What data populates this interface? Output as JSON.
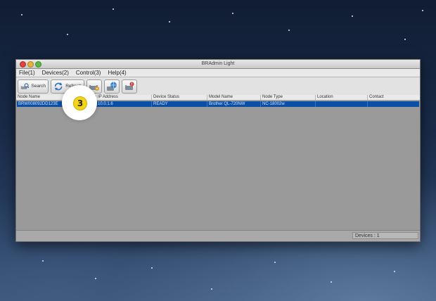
{
  "window": {
    "title": "BRAdmin Light"
  },
  "menubar": {
    "items": [
      "File(1)",
      "Devices(2)",
      "Control(3)",
      "Help(4)"
    ]
  },
  "toolbar": {
    "search_label": "Search",
    "refresh_label": "Refresh"
  },
  "table": {
    "columns": [
      "Node Name",
      "IP Address",
      "Device Status",
      "Model Name",
      "Node Type",
      "Location",
      "Contact"
    ],
    "rows": [
      {
        "node_name": "BRW008092DD123E",
        "ip_address": "10.0.1.6",
        "device_status": "READY",
        "model_name": "Brother QL-720NW",
        "node_type": "NC-18002w",
        "location": "",
        "contact": ""
      }
    ]
  },
  "status": {
    "devices": "Devices : 1"
  },
  "callout": {
    "step": "3"
  },
  "colors": {
    "selection": "#0a4fa6",
    "callout_badge": "#f2d51a"
  }
}
